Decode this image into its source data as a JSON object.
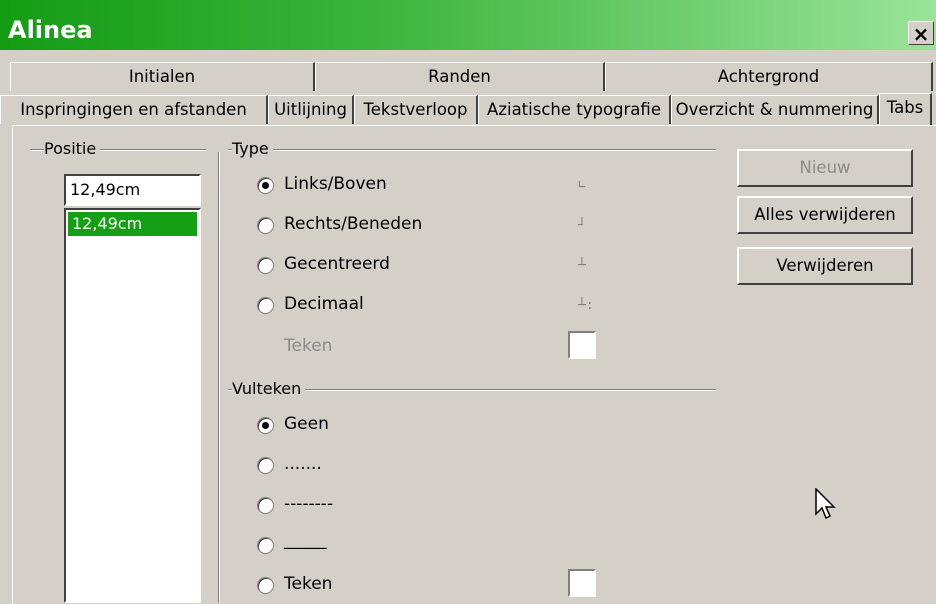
{
  "window": {
    "title": "Alinea",
    "close_glyph": "×"
  },
  "tabs_row1": [
    "Initialen",
    "Randen",
    "Achtergrond"
  ],
  "tabs_row2": [
    "Inspringingen en afstanden",
    "Uitlijning",
    "Tekstverloop",
    "Aziatische typografie",
    "Overzicht & nummering",
    "Tabs"
  ],
  "active_tab": "Tabs",
  "position": {
    "group_label": "Positie",
    "input_value": "12,49cm",
    "list": [
      "12,49cm"
    ]
  },
  "type": {
    "group_label": "Type",
    "options": [
      {
        "label": "Links/Boven",
        "selected": true,
        "icon": "left-tab-icon"
      },
      {
        "label": "Rechts/Beneden",
        "selected": false,
        "icon": "right-tab-icon"
      },
      {
        "label": "Gecentreerd",
        "selected": false,
        "icon": "center-tab-icon"
      },
      {
        "label": "Decimaal",
        "selected": false,
        "icon": "decimal-tab-icon"
      }
    ],
    "teken_label": "Teken"
  },
  "fill": {
    "group_label": "Vulteken",
    "options": [
      {
        "label": "Geen",
        "selected": true
      },
      {
        "label": ".......",
        "selected": false
      },
      {
        "label": "--------",
        "selected": false
      },
      {
        "label": "_____",
        "selected": false
      },
      {
        "label": "Teken",
        "selected": false
      }
    ]
  },
  "buttons": {
    "new": "Nieuw",
    "delete_all": "Alles verwijderen",
    "delete": "Verwijderen"
  }
}
